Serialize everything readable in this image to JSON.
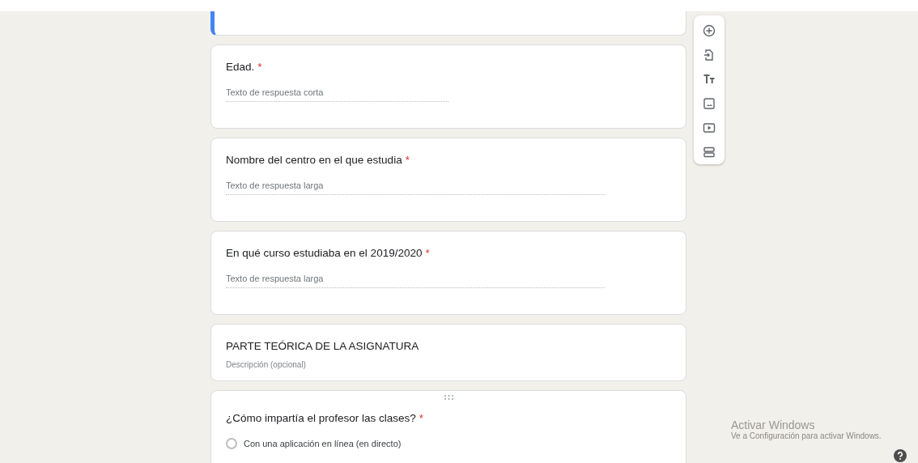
{
  "questions": [
    {
      "kind": "hidden",
      "selected": true
    },
    {
      "kind": "short_answer",
      "selected": false,
      "title": "Edad.",
      "required_mark": "*",
      "placeholder": "Texto de respuesta corta"
    },
    {
      "kind": "paragraph",
      "selected": false,
      "title": "Nombre del centro en el que estudia",
      "required_mark": "*",
      "placeholder": "Texto de respuesta larga"
    },
    {
      "kind": "paragraph",
      "selected": false,
      "title": "En qué curso estudiaba en el 2019/2020",
      "required_mark": "*",
      "placeholder": "Texto de respuesta larga"
    },
    {
      "kind": "section",
      "selected": false,
      "title": "PARTE TEÓRICA DE LA ASIGNATURA",
      "description": "Descripción (opcional)"
    },
    {
      "kind": "multiple_choice",
      "selected": false,
      "title": "¿Cómo impartía el profesor las clases?",
      "required_mark": "*",
      "options": [
        {
          "label": "Con una aplicación en línea (en directo)",
          "selected": false
        }
      ]
    }
  ],
  "os_notice": {
    "title": "Activar Windows",
    "text": "Ve a Configuración para activar Windows."
  }
}
